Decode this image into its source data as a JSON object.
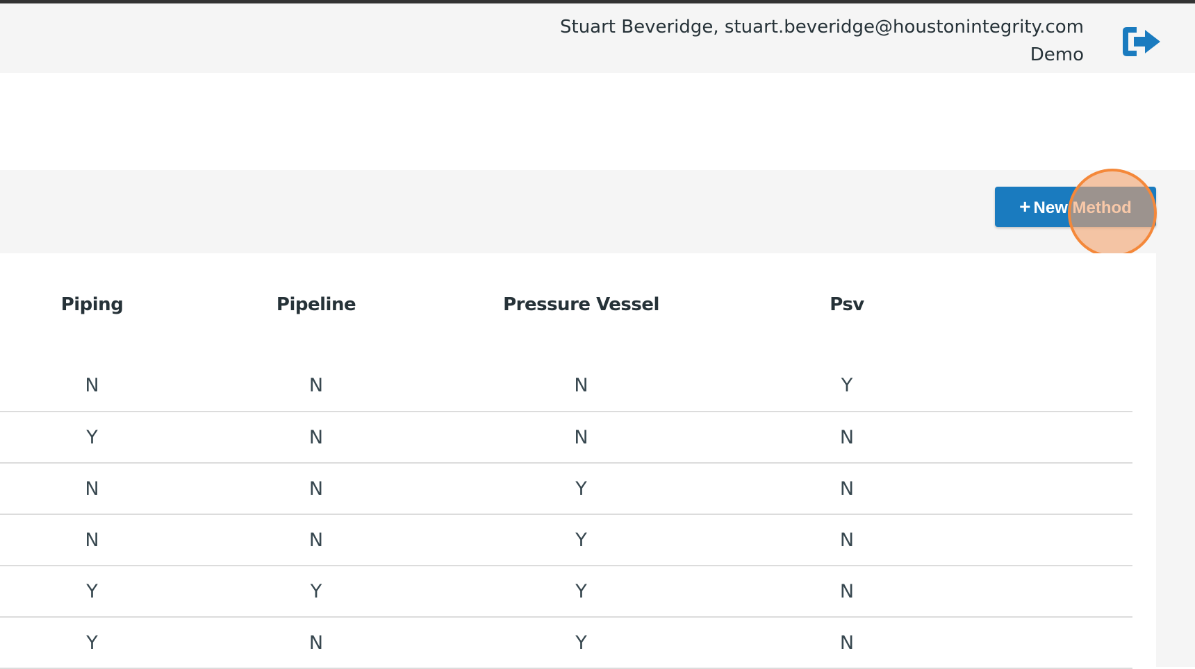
{
  "header": {
    "user_line": "Stuart Beveridge, stuart.beveridge@houstonintegrity.com",
    "tenant": "Demo",
    "logout_icon": "sign-out-icon",
    "accent_color": "#1a7bbf"
  },
  "toolbar": {
    "new_method_plus": "+",
    "new_method_label": "New Method"
  },
  "table": {
    "columns": [
      "Piping",
      "Pipeline",
      "Pressure Vessel",
      "Psv"
    ],
    "rows": [
      [
        "N",
        "N",
        "N",
        "Y"
      ],
      [
        "Y",
        "N",
        "N",
        "N"
      ],
      [
        "N",
        "N",
        "Y",
        "N"
      ],
      [
        "N",
        "N",
        "Y",
        "N"
      ],
      [
        "Y",
        "Y",
        "Y",
        "N"
      ],
      [
        "Y",
        "N",
        "Y",
        "N"
      ]
    ]
  }
}
